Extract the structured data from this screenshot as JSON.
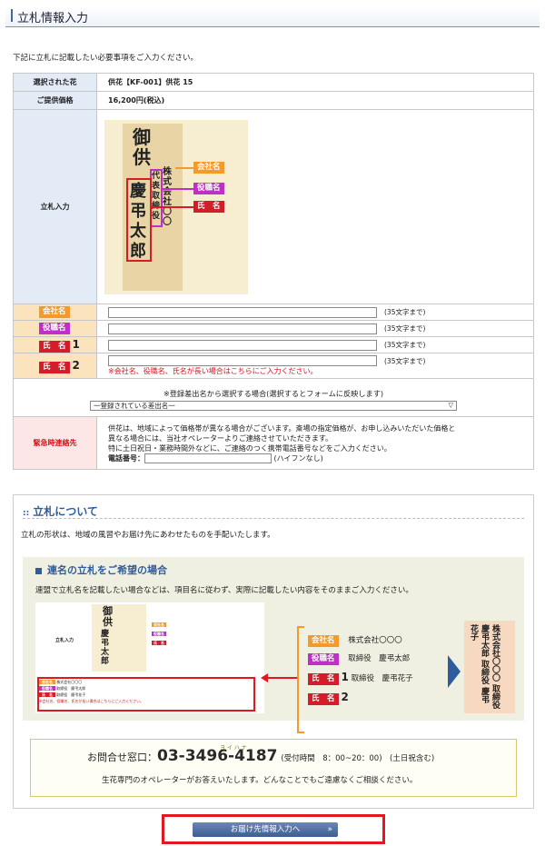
{
  "header": {
    "title": "立札情報入力"
  },
  "intro": "下記に立札に記載したい必要事項をご入力ください。",
  "form": {
    "selected_label": "選択された花",
    "selected_value": "供花【KF-001】供花 15",
    "price_label": "ご提供価格",
    "price_value": "16,200円(税込)",
    "tatefuda_label": "立札入力",
    "plate": {
      "top": "御供",
      "company": "株式会社〇〇",
      "role": "代表取締役",
      "name": "慶弔 太郎"
    },
    "tags": {
      "company": "会社名",
      "role": "役職名",
      "name": "氏　名"
    },
    "limit": "(35文字まで)",
    "num1": "1",
    "num2": "2",
    "warning": "※会社名、役職名、氏名が長い場合はこちらにご入力ください。",
    "registered_note": "※登録差出名から選択する場合(選択するとフォームに反映します)",
    "registered_select": "一登録されている差出名一",
    "emergency_label": "緊急時連絡先",
    "emergency_text1": "供花は、地域によって価格帯が異なる場合がございます。斎場の指定価格が、お申し込みいただいた価格と",
    "emergency_text2": "異なる場合には、当社オペレーターよりご連絡させていただきます。",
    "emergency_text3": "特に土日祝日・業務時間外などに、ご連絡のつく携帯電話番号などをご入力ください。",
    "phone_label": "電話番号：",
    "phone_hint": "(ハイフンなし)"
  },
  "about": {
    "title": "立札について",
    "desc": "立札の形状は、地域の風習やお届け先にあわせたものを手配いたします。",
    "joint_title": "連名の立札をご希望の場合",
    "joint_desc": "連盟で立札名を記載したい場合などは、項目名に従わず、実際に記載したい内容をそのままご入力ください。",
    "ex_company": "株式会社〇〇〇",
    "ex_role": "取締役　慶弔太郎",
    "ex_name1": "取締役　慶弔花子",
    "ex_num1": "1",
    "ex_num2": "2",
    "vertical": "株式会社〇〇〇 取締役 慶弔太郎 取締役 慶弔花子"
  },
  "contact": {
    "ruby": "ヨ イ ハ ナ",
    "label": "お問合せ窓口：",
    "phone": "03-3496-4187",
    "hours": "(受付時間　8：00~20：00)　(土日祝含む)",
    "note": "生花専門のオペレーターがお答えいたします。どんなことでもご遠慮なくご相談ください。"
  },
  "button": {
    "label": "お届け先情報入力へ"
  }
}
